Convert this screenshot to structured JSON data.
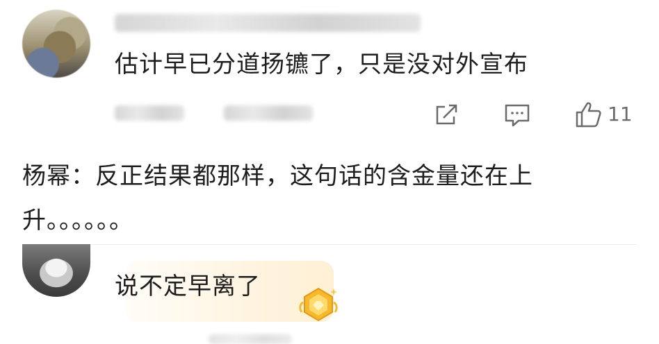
{
  "comment1": {
    "text": "估计早已分道扬镳了，只是没对外宣布",
    "likes": "11",
    "icons": {
      "share": "share-icon",
      "reply": "comment-icon",
      "like": "thumb-up-icon"
    }
  },
  "reply": {
    "text": "杨幂：反正结果都那样，这句话的含金量还在上升。。。。。。"
  },
  "comment2": {
    "text": "说不定早离了",
    "badge_icon": "gold-badge-icon"
  },
  "colors": {
    "text": "#1d1d1d",
    "muted": "#6a6a6a",
    "divider": "#ececec",
    "bubble": "#fff4e0",
    "badge_gold": "#f5b82e"
  }
}
